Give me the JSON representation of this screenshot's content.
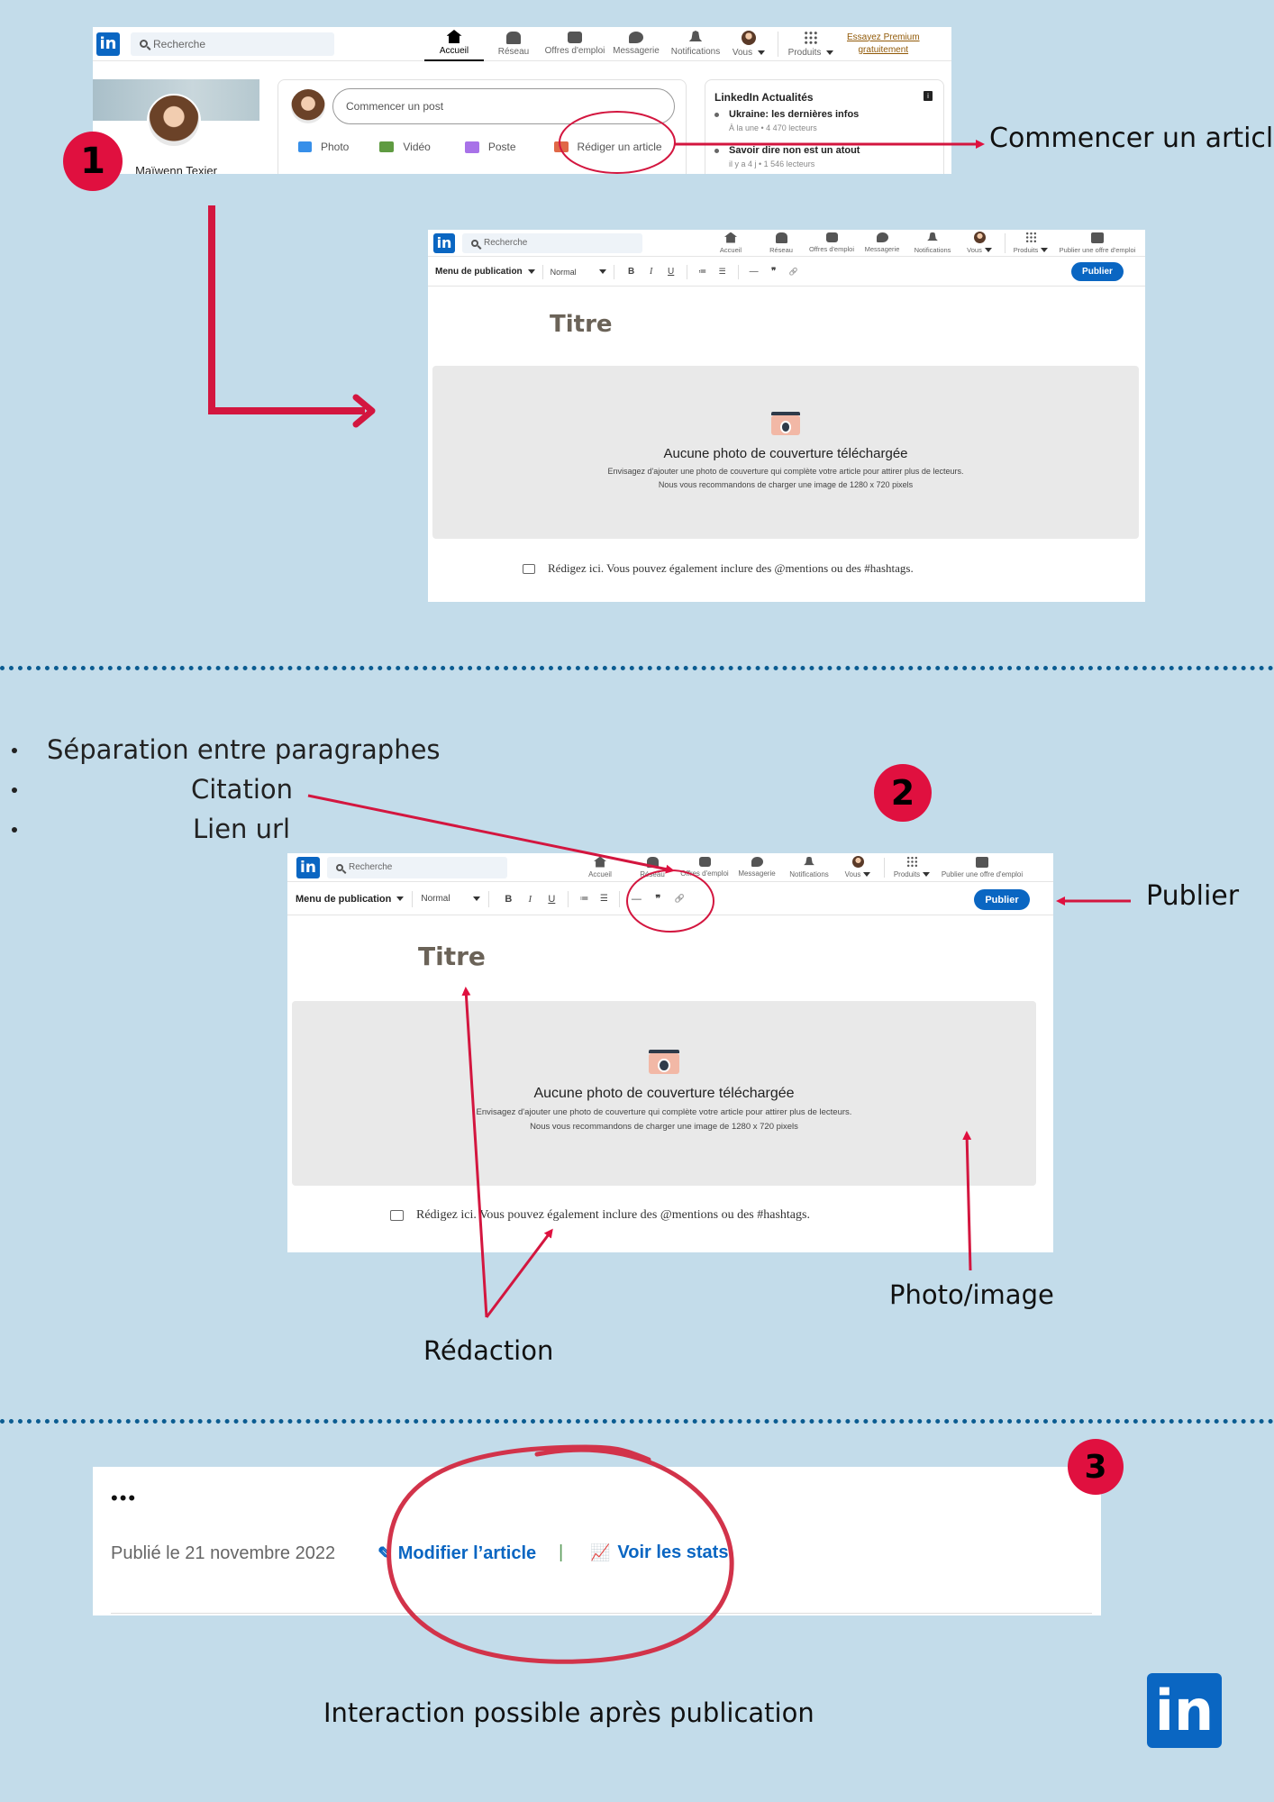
{
  "colors": {
    "background": "#c3dcea",
    "accent_red": "#e0103f",
    "linkedin_blue": "#0a66c2",
    "dotted_separator": "#0b5c91"
  },
  "linkedin_logo": "in",
  "step1": {
    "badge": "1",
    "search_placeholder": "Recherche",
    "nav": [
      "Accueil",
      "Réseau",
      "Offres d'emploi",
      "Messagerie",
      "Notifications",
      "Vous",
      "Produits"
    ],
    "premium_line1": "Essayez Premium",
    "premium_line2": "gratuitement",
    "profile_name": "Maïwenn Texier",
    "post_placeholder": "Commencer un post",
    "actions": [
      "Photo",
      "Vidéo",
      "Poste",
      "Rédiger un article"
    ],
    "news_title": "LinkedIn Actualités",
    "news_info_icon": "i",
    "news": [
      {
        "title": "Ukraine: les dernières infos",
        "meta": "À la une • 4 470 lecteurs"
      },
      {
        "title": "Savoir dire non est un atout",
        "meta": "il y a 4 j • 1 546 lecteurs"
      }
    ],
    "callout": "Commencer un article"
  },
  "editor": {
    "search_placeholder": "Recherche",
    "nav": [
      "Accueil",
      "Réseau",
      "Offres d'emploi",
      "Messagerie",
      "Notifications",
      "Vous",
      "Produits",
      "Publier une offre d'emploi"
    ],
    "menu": "Menu de publication",
    "style": "Normal",
    "bold": "B",
    "italic": "I",
    "underline": "U",
    "list_numbered": "≔",
    "list_bullets": "☰",
    "divider_tool": "—",
    "quote_tool": "❞",
    "link_tool": "🔗",
    "publish": "Publier",
    "title_placeholder": "Titre",
    "cover_title": "Aucune photo de couverture téléchargée",
    "cover_line1": "Envisagez d'ajouter une photo de couverture qui complète votre article pour attirer plus de lecteurs.",
    "cover_line2": "Nous vous recommandons de charger une image de 1280 x 720 pixels",
    "body_placeholder": "Rédigez ici. Vous pouvez également inclure des @mentions ou des #hashtags."
  },
  "step2": {
    "badge": "2",
    "bullets": [
      "Séparation entre paragraphes",
      "Citation",
      "Lien url"
    ],
    "publish_label": "Publier",
    "photo_label": "Photo/image",
    "redaction_label": "Rédaction"
  },
  "step3": {
    "badge": "3",
    "more": "•••",
    "published": "Publié le 21 novembre 2022",
    "edit": "Modifier l’article",
    "divider": "|",
    "stats": "Voir les stats",
    "caption": "Interaction possible après publication"
  }
}
